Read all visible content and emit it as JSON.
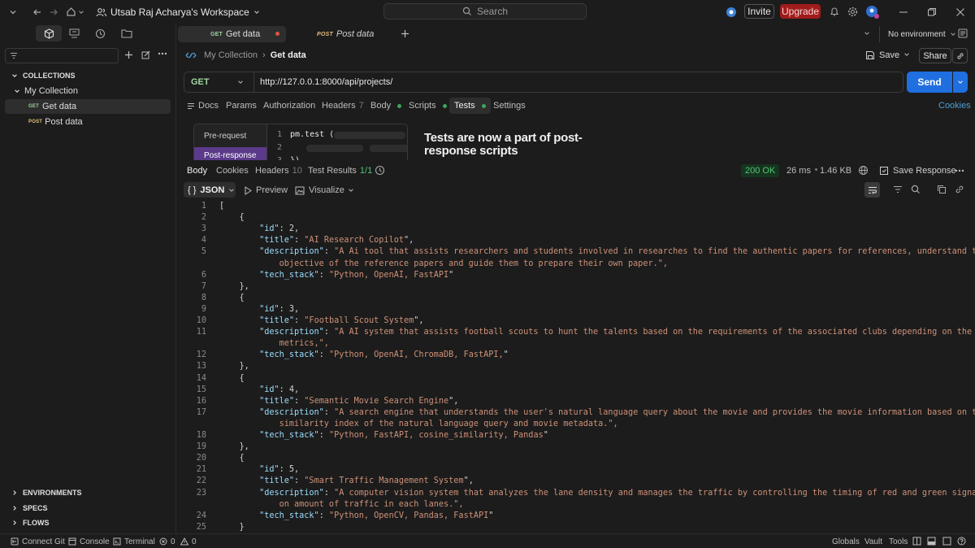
{
  "topbar": {
    "workspace": "Utsab Raj Acharya's Workspace",
    "search_placeholder": "Search",
    "invite": "Invite",
    "upgrade": "Upgrade"
  },
  "tabs": {
    "get_tag": "GET",
    "get_label": "Get data",
    "post_tag": "POST",
    "post_label": "Post data",
    "environment": "No environment"
  },
  "sidebar": {
    "collections_heading": "COLLECTIONS",
    "collection_name": "My Collection",
    "items": [
      {
        "tag": "GET",
        "label": "Get data"
      },
      {
        "tag": "POST",
        "label": "Post data"
      }
    ],
    "environments": "ENVIRONMENTS",
    "specs": "SPECS",
    "flows": "FLOWS"
  },
  "request": {
    "breadcrumb_collection": "My Collection",
    "breadcrumb_request": "Get data",
    "save_label": "Save",
    "share_label": "Share",
    "method": "GET",
    "url": "http://127.0.0.1:8000/api/projects/",
    "send_label": "Send",
    "tabs": {
      "docs": "Docs",
      "params": "Params",
      "authorization": "Authorization",
      "headers": "Headers",
      "headers_count": "7",
      "body": "Body",
      "scripts": "Scripts",
      "tests": "Tests",
      "settings": "Settings",
      "cookies": "Cookies"
    }
  },
  "tests": {
    "pre_request": "Pre-request",
    "post_response": "Post-response",
    "code_line1": "pm.test (",
    "code_line3": "})",
    "headline": "Tests are now a part of post-response scripts"
  },
  "response": {
    "tabs": {
      "body": "Body",
      "cookies": "Cookies",
      "headers": "Headers",
      "headers_count": "10",
      "test_results": "Test Results",
      "test_results_count": "1/1"
    },
    "status": "200 OK",
    "time": "26 ms",
    "size": "1.46 KB",
    "save_response": "Save Response",
    "format": "JSON",
    "preview": "Preview",
    "visualize": "Visualize"
  },
  "code_lines": [
    {
      "n": "1",
      "t": "["
    },
    {
      "n": "2",
      "t": "    {"
    },
    {
      "n": "3",
      "t": "        \"id\": 2,"
    },
    {
      "n": "4",
      "t": "        \"title\": \"AI Research Copilot\","
    },
    {
      "n": "5",
      "t": "        \"description\": \"A Ai tool that assists researchers and students involved in researches to find the authentic papers for references, understand the main"
    },
    {
      "n": "",
      "t": "            objective of the reference papers and guide them to prepare their own paper.\","
    },
    {
      "n": "6",
      "t": "        \"tech_stack\": \"Python, OpenAI, FastAPI\""
    },
    {
      "n": "7",
      "t": "    },"
    },
    {
      "n": "8",
      "t": "    {"
    },
    {
      "n": "9",
      "t": "        \"id\": 3,"
    },
    {
      "n": "10",
      "t": "        \"title\": \"Football Scout System\","
    },
    {
      "n": "11",
      "t": "        \"description\": \"A AI system that assists football scouts to hunt the talents based on the requirements of the associated clubs depending on the various"
    },
    {
      "n": "",
      "t": "            metrics,\","
    },
    {
      "n": "12",
      "t": "        \"tech_stack\": \"Python, OpenAI, ChromaDB, FastAPI,\""
    },
    {
      "n": "13",
      "t": "    },"
    },
    {
      "n": "14",
      "t": "    {"
    },
    {
      "n": "15",
      "t": "        \"id\": 4,"
    },
    {
      "n": "16",
      "t": "        \"title\": \"Semantic Movie Search Engine\","
    },
    {
      "n": "17",
      "t": "        \"description\": \"A search engine that understands the user's natural language query about the movie and provides the movie information based on the"
    },
    {
      "n": "",
      "t": "            similarity index of the natural language query and movie metadata.\","
    },
    {
      "n": "18",
      "t": "        \"tech_stack\": \"Python, FastAPI, cosine_similarity, Pandas\""
    },
    {
      "n": "19",
      "t": "    },"
    },
    {
      "n": "20",
      "t": "    {"
    },
    {
      "n": "21",
      "t": "        \"id\": 5,"
    },
    {
      "n": "22",
      "t": "        \"title\": \"Smart Traffic Management System\","
    },
    {
      "n": "23",
      "t": "        \"description\": \"A computer vision system that analyzes the lane density and manages the traffic by controlling the timing of red and green signal based"
    },
    {
      "n": "",
      "t": "            on amount of traffic in each lanes.\","
    },
    {
      "n": "24",
      "t": "        \"tech_stack\": \"Python, OpenCV, Pandas, FastAPI\""
    },
    {
      "n": "25",
      "t": "    }"
    }
  ],
  "statusbar": {
    "connect_git": "Connect Git",
    "console": "Console",
    "terminal": "Terminal",
    "errors": "0",
    "warnings": "0",
    "globals": "Globals",
    "vault": "Vault",
    "tools": "Tools"
  },
  "colors": {
    "accent": "#1f6fe0",
    "get_method": "#9fd59f",
    "post_method": "#e5c07b",
    "upgrade": "#a01b1b",
    "status_ok": "#55c377"
  }
}
